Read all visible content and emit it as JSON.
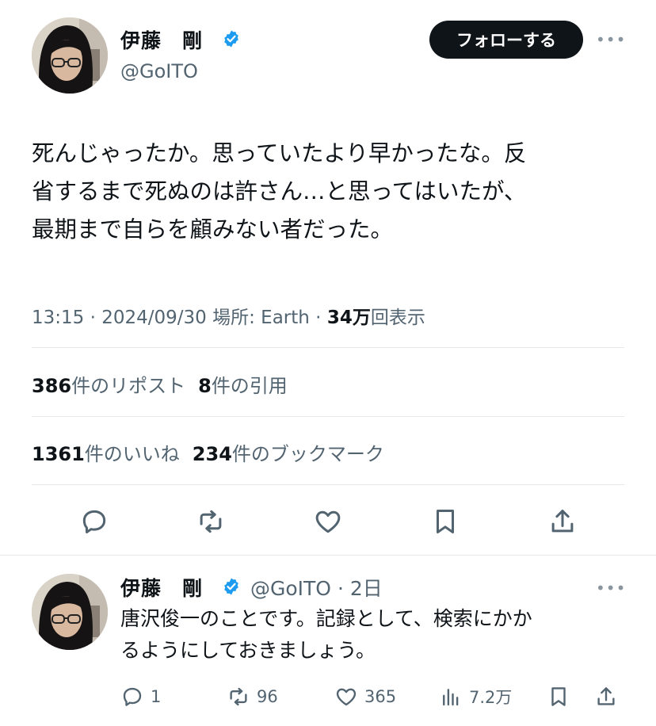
{
  "tweet": {
    "author": {
      "name": "伊藤　剛",
      "handle": "@GoITO"
    },
    "follow_label": "フォローする",
    "more_label": "•••",
    "text": "死んじゃったか。思っていたより早かったな。反\n省するまで死ぬのは許さん…と思ってはいたが、\n最期まで自らを顧みない者だった。",
    "meta": {
      "time": "13:15",
      "sep1": " · ",
      "date": "2024/09/30",
      "location": " 場所: Earth",
      "sep2": " · ",
      "views_number": "34万",
      "views_label": "回表示"
    },
    "stats": {
      "reposts_count": "386",
      "reposts_label": "件のリポスト",
      "quotes_count": "8",
      "quotes_label": "件の引用",
      "likes_count": "1361",
      "likes_label": "件のいいね",
      "bookmarks_count": "234",
      "bookmarks_label": "件のブックマーク"
    }
  },
  "reply": {
    "author": {
      "name": "伊藤　剛",
      "handle": "@GoITO",
      "time": " · 2日"
    },
    "more_label": "•••",
    "text": "唐沢俊一のことです。記録として、検索にかか\nるようにしておきましょう。",
    "actions": {
      "replies": "1",
      "reposts": "96",
      "likes": "365",
      "views": "7.2万"
    }
  },
  "icons": {
    "verified_badge": "verified-badge-icon",
    "reply": "reply-icon",
    "repost": "repost-icon",
    "like": "heart-icon",
    "bookmark": "bookmark-icon",
    "share": "share-icon",
    "views": "views-chart-icon"
  },
  "colors": {
    "verified": "#1d9bf0",
    "text_primary": "#0f1419",
    "text_secondary": "#536471",
    "follow_button_bg": "#0f1419"
  }
}
